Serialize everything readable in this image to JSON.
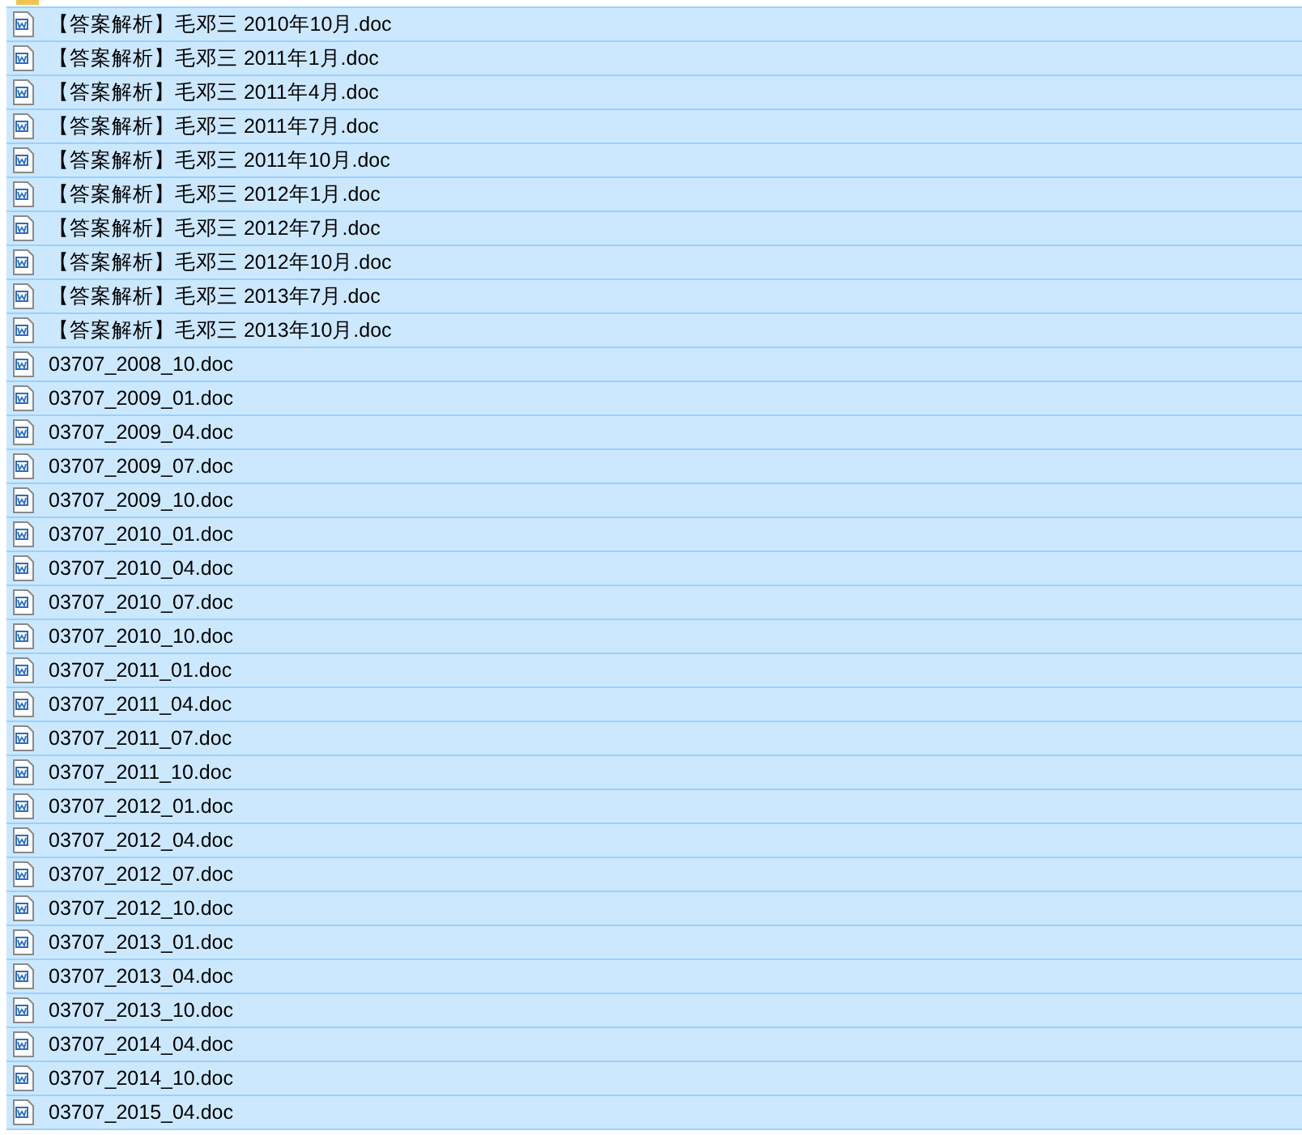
{
  "files": [
    {
      "name": "【答案解析】毛邓三 2010年10月.doc",
      "selected": true
    },
    {
      "name": "【答案解析】毛邓三 2011年1月.doc",
      "selected": true
    },
    {
      "name": "【答案解析】毛邓三 2011年4月.doc",
      "selected": true
    },
    {
      "name": "【答案解析】毛邓三 2011年7月.doc",
      "selected": true
    },
    {
      "name": "【答案解析】毛邓三 2011年10月.doc",
      "selected": true
    },
    {
      "name": "【答案解析】毛邓三 2012年1月.doc",
      "selected": true
    },
    {
      "name": "【答案解析】毛邓三 2012年7月.doc",
      "selected": true
    },
    {
      "name": "【答案解析】毛邓三 2012年10月.doc",
      "selected": true
    },
    {
      "name": "【答案解析】毛邓三 2013年7月.doc",
      "selected": true
    },
    {
      "name": "【答案解析】毛邓三 2013年10月.doc",
      "selected": true
    },
    {
      "name": "03707_2008_10.doc",
      "selected": true
    },
    {
      "name": "03707_2009_01.doc",
      "selected": true
    },
    {
      "name": "03707_2009_04.doc",
      "selected": true
    },
    {
      "name": "03707_2009_07.doc",
      "selected": true
    },
    {
      "name": "03707_2009_10.doc",
      "selected": true
    },
    {
      "name": "03707_2010_01.doc",
      "selected": true
    },
    {
      "name": "03707_2010_04.doc",
      "selected": true
    },
    {
      "name": "03707_2010_07.doc",
      "selected": true
    },
    {
      "name": "03707_2010_10.doc",
      "selected": true
    },
    {
      "name": "03707_2011_01.doc",
      "selected": true
    },
    {
      "name": "03707_2011_04.doc",
      "selected": true
    },
    {
      "name": "03707_2011_07.doc",
      "selected": true
    },
    {
      "name": "03707_2011_10.doc",
      "selected": true
    },
    {
      "name": "03707_2012_01.doc",
      "selected": true
    },
    {
      "name": "03707_2012_04.doc",
      "selected": true
    },
    {
      "name": "03707_2012_07.doc",
      "selected": true
    },
    {
      "name": "03707_2012_10.doc",
      "selected": true
    },
    {
      "name": "03707_2013_01.doc",
      "selected": true
    },
    {
      "name": "03707_2013_04.doc",
      "selected": true
    },
    {
      "name": "03707_2013_10.doc",
      "selected": true
    },
    {
      "name": "03707_2014_04.doc",
      "selected": true
    },
    {
      "name": "03707_2014_10.doc",
      "selected": true
    },
    {
      "name": "03707_2015_04.doc",
      "selected": true
    }
  ]
}
